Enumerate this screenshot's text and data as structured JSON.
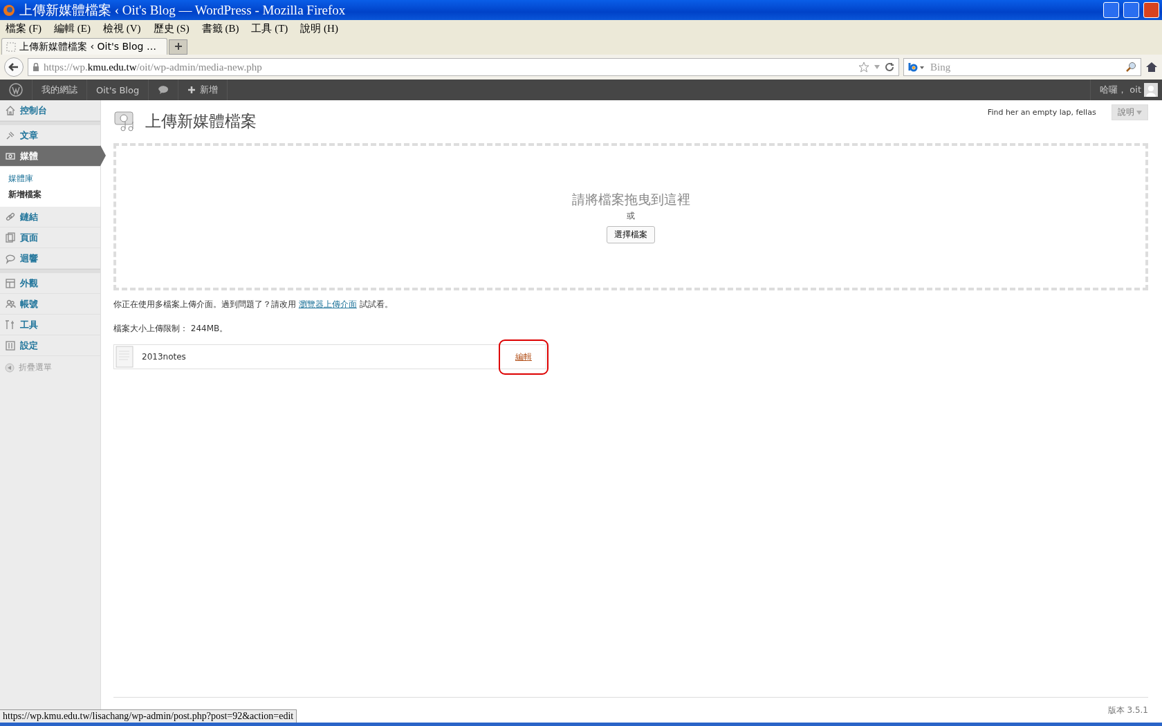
{
  "window": {
    "title": "上傳新媒體檔案 ‹ Oit's Blog — WordPress - Mozilla Firefox"
  },
  "menu_bar": [
    "檔案 (F)",
    "編輯 (E)",
    "檢視 (V)",
    "歷史 (S)",
    "書籤 (B)",
    "工具 (T)",
    "說明 (H)"
  ],
  "tabs": [
    {
      "label": "上傳新媒體檔案 ‹ Oit's Blog …",
      "selected": true
    }
  ],
  "address_bar": {
    "scheme": "https://wp.",
    "domain": "kmu.edu.tw",
    "path": "/oit/wp-admin/media-new.php"
  },
  "search": {
    "placeholder": "Bing"
  },
  "admin_bar": {
    "items": [
      "我的網誌",
      "Oit's Blog",
      "新增"
    ],
    "greeting": "哈囉， oit"
  },
  "sidebar": {
    "groups": [
      [
        {
          "label": "控制台",
          "selected": false
        }
      ],
      [
        {
          "label": "文章",
          "selected": false
        },
        {
          "label": "媒體",
          "selected": true,
          "children": [
            {
              "label": "媒體庫",
              "selected": false
            },
            {
              "label": "新增檔案",
              "selected": true
            }
          ]
        },
        {
          "label": "鏈結",
          "selected": false
        },
        {
          "label": "頁面",
          "selected": false
        },
        {
          "label": "迴響",
          "selected": false
        }
      ],
      [
        {
          "label": "外觀",
          "selected": false
        },
        {
          "label": "帳號",
          "selected": false
        },
        {
          "label": "工具",
          "selected": false
        },
        {
          "label": "設定",
          "selected": false
        }
      ]
    ],
    "collapse": "折疊選單"
  },
  "header": {
    "tagline": "Find her an empty lap, fellas",
    "help_tab": "說明"
  },
  "page": {
    "title": "上傳新媒體檔案",
    "drop_zone": {
      "heading": "請將檔案拖曳到這裡",
      "or": "或",
      "button": "選擇檔案"
    },
    "notice": {
      "before": "你正在使用多檔案上傳介面。過到問題了？請改用",
      "link": "瀏覽器上傳介面",
      "after": "試試看。"
    },
    "limit": "檔案大小上傳限制： 244MB。",
    "files": [
      {
        "name": "2013notes",
        "action": "編輯",
        "highlighted": true
      }
    ]
  },
  "footer": {
    "version": "版本 3.5.1"
  },
  "status_bar": {
    "url": "https://wp.kmu.edu.tw/lisachang/wp-admin/post.php?post=92&action=edit"
  }
}
